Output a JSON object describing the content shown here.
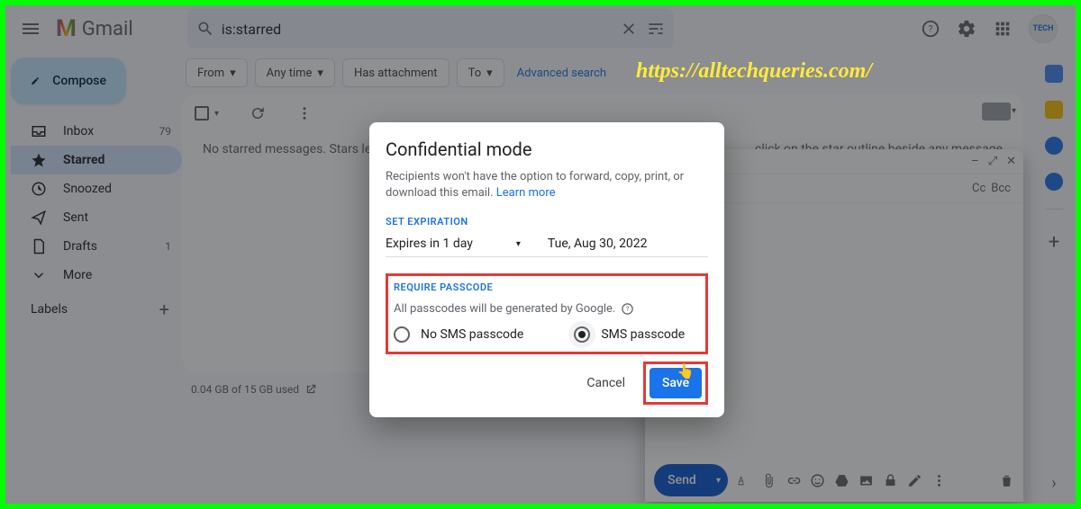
{
  "header": {
    "logo_text": "Gmail",
    "search_value": "is:starred"
  },
  "watermark": "https://alltechqueries.com/",
  "sidebar": {
    "compose_label": "Compose",
    "items": [
      {
        "label": "Inbox",
        "count": "79"
      },
      {
        "label": "Starred",
        "count": ""
      },
      {
        "label": "Snoozed",
        "count": ""
      },
      {
        "label": "Sent",
        "count": ""
      },
      {
        "label": "Drafts",
        "count": "1"
      },
      {
        "label": "More",
        "count": ""
      }
    ],
    "labels_heading": "Labels"
  },
  "filters": {
    "from": "From",
    "any_time": "Any time",
    "has_attachment": "Has attachment",
    "to": "To",
    "advanced": "Advanced search"
  },
  "empty_prefix": "No starred messages. Stars let yo",
  "empty_suffix": ", click on the star outline beside any message or conversation.",
  "storage": "0.04 GB of 15 GB used",
  "compose_panel": {
    "cc": "Cc",
    "bcc": "Bcc",
    "send": "Send"
  },
  "modal": {
    "title": "Confidential mode",
    "desc_pre": "Recipients won't have the option to forward, copy, print, or download this email. ",
    "learn_more": "Learn more",
    "set_expiration": "SET EXPIRATION",
    "expires_value": "Expires in 1 day",
    "expires_date": "Tue, Aug 30, 2022",
    "require_passcode": "REQUIRE PASSCODE",
    "passcode_sub": "All passcodes will be generated by Google.",
    "no_sms": "No SMS passcode",
    "sms": "SMS passcode",
    "cancel": "Cancel",
    "save": "Save"
  }
}
